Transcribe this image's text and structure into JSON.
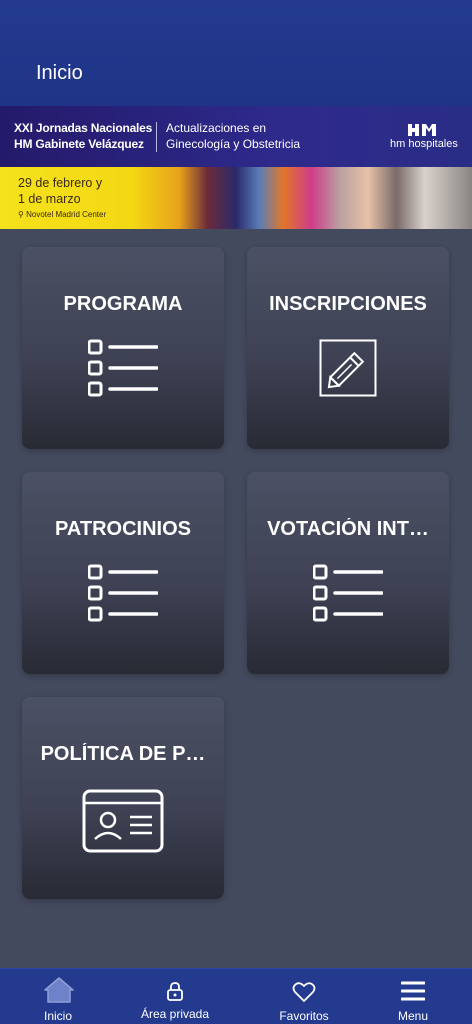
{
  "header": {
    "title": "Inicio"
  },
  "banner": {
    "event_line1": "XXI Jornadas Nacionales",
    "event_line2": "HM Gabinete Velázquez",
    "subtitle_line1": "Actualizaciones en",
    "subtitle_line2": "Ginecología y Obstetricia",
    "brand": "hm hospitales",
    "date_line1": "29 de febrero y",
    "date_line2": "1 de marzo",
    "venue": "Novotel Madrid Center"
  },
  "tiles": [
    {
      "label": "PROGRAMA",
      "icon": "list-icon"
    },
    {
      "label": "INSCRIPCIONES",
      "icon": "pencil-icon"
    },
    {
      "label": "PATROCINIOS",
      "icon": "list-icon"
    },
    {
      "label": "VOTACIÓN INT…",
      "icon": "list-icon"
    },
    {
      "label": "POLÍTICA DE P…",
      "icon": "id-card-icon"
    }
  ],
  "bottom_nav": [
    {
      "label": "Inicio",
      "icon": "home-icon"
    },
    {
      "label": "Área privada",
      "icon": "lock-icon"
    },
    {
      "label": "Favoritos",
      "icon": "heart-icon"
    },
    {
      "label": "Menu",
      "icon": "menu-icon"
    }
  ],
  "colors": {
    "header": "#233a8f",
    "background": "#444a5e",
    "nav_active": "#6d82c8"
  }
}
